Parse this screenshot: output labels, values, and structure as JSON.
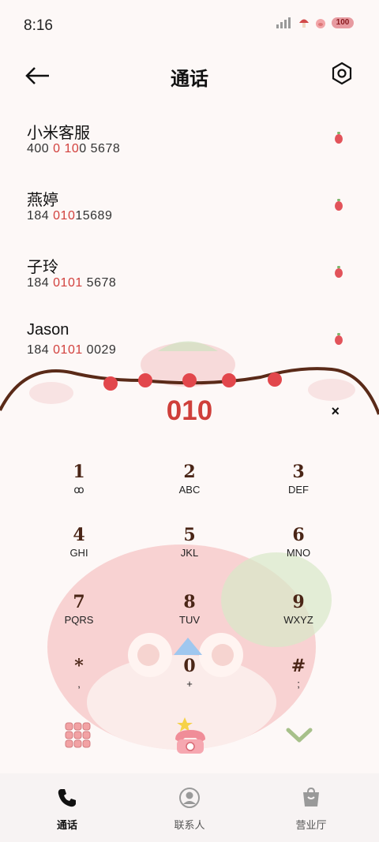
{
  "status_bar": {
    "time": "8:16",
    "battery": "100"
  },
  "header": {
    "title": "通话"
  },
  "contacts": [
    {
      "name": "小米客服",
      "num_pre": "400 ",
      "num_hl1": "0",
      "num_mid": " ",
      "num_hl2": "10",
      "num_post": "0 5678"
    },
    {
      "name": "燕婷",
      "num_pre": "184 ",
      "num_hl1": "010",
      "num_mid": "",
      "num_hl2": "",
      "num_post": "15689"
    },
    {
      "name": "子玲",
      "num_pre": "184 ",
      "num_hl1": "0101",
      "num_mid": "",
      "num_hl2": "",
      "num_post": " 5678"
    },
    {
      "name": "Jason",
      "num_pre": "184 ",
      "num_hl1": "0101",
      "num_mid": "",
      "num_hl2": "",
      "num_post": " 0029"
    }
  ],
  "dialer": {
    "input": "010",
    "clear": "×"
  },
  "keys": [
    {
      "digit": "1",
      "letters": "ꝏ"
    },
    {
      "digit": "2",
      "letters": "ABC"
    },
    {
      "digit": "3",
      "letters": "DEF"
    },
    {
      "digit": "4",
      "letters": "GHI"
    },
    {
      "digit": "5",
      "letters": "JKL"
    },
    {
      "digit": "6",
      "letters": "MNO"
    },
    {
      "digit": "7",
      "letters": "PQRS"
    },
    {
      "digit": "8",
      "letters": "TUV"
    },
    {
      "digit": "9",
      "letters": "WXYZ"
    },
    {
      "digit": "*",
      "letters": ","
    },
    {
      "digit": "0",
      "letters": "+"
    },
    {
      "digit": "#",
      "letters": ";"
    }
  ],
  "tabs": [
    {
      "label": "通话",
      "icon": "phone-icon"
    },
    {
      "label": "联系人",
      "icon": "person-icon"
    },
    {
      "label": "营业厅",
      "icon": "shop-icon"
    }
  ],
  "colors": {
    "accent": "#cf3f3a",
    "background": "#fdf8f7"
  }
}
